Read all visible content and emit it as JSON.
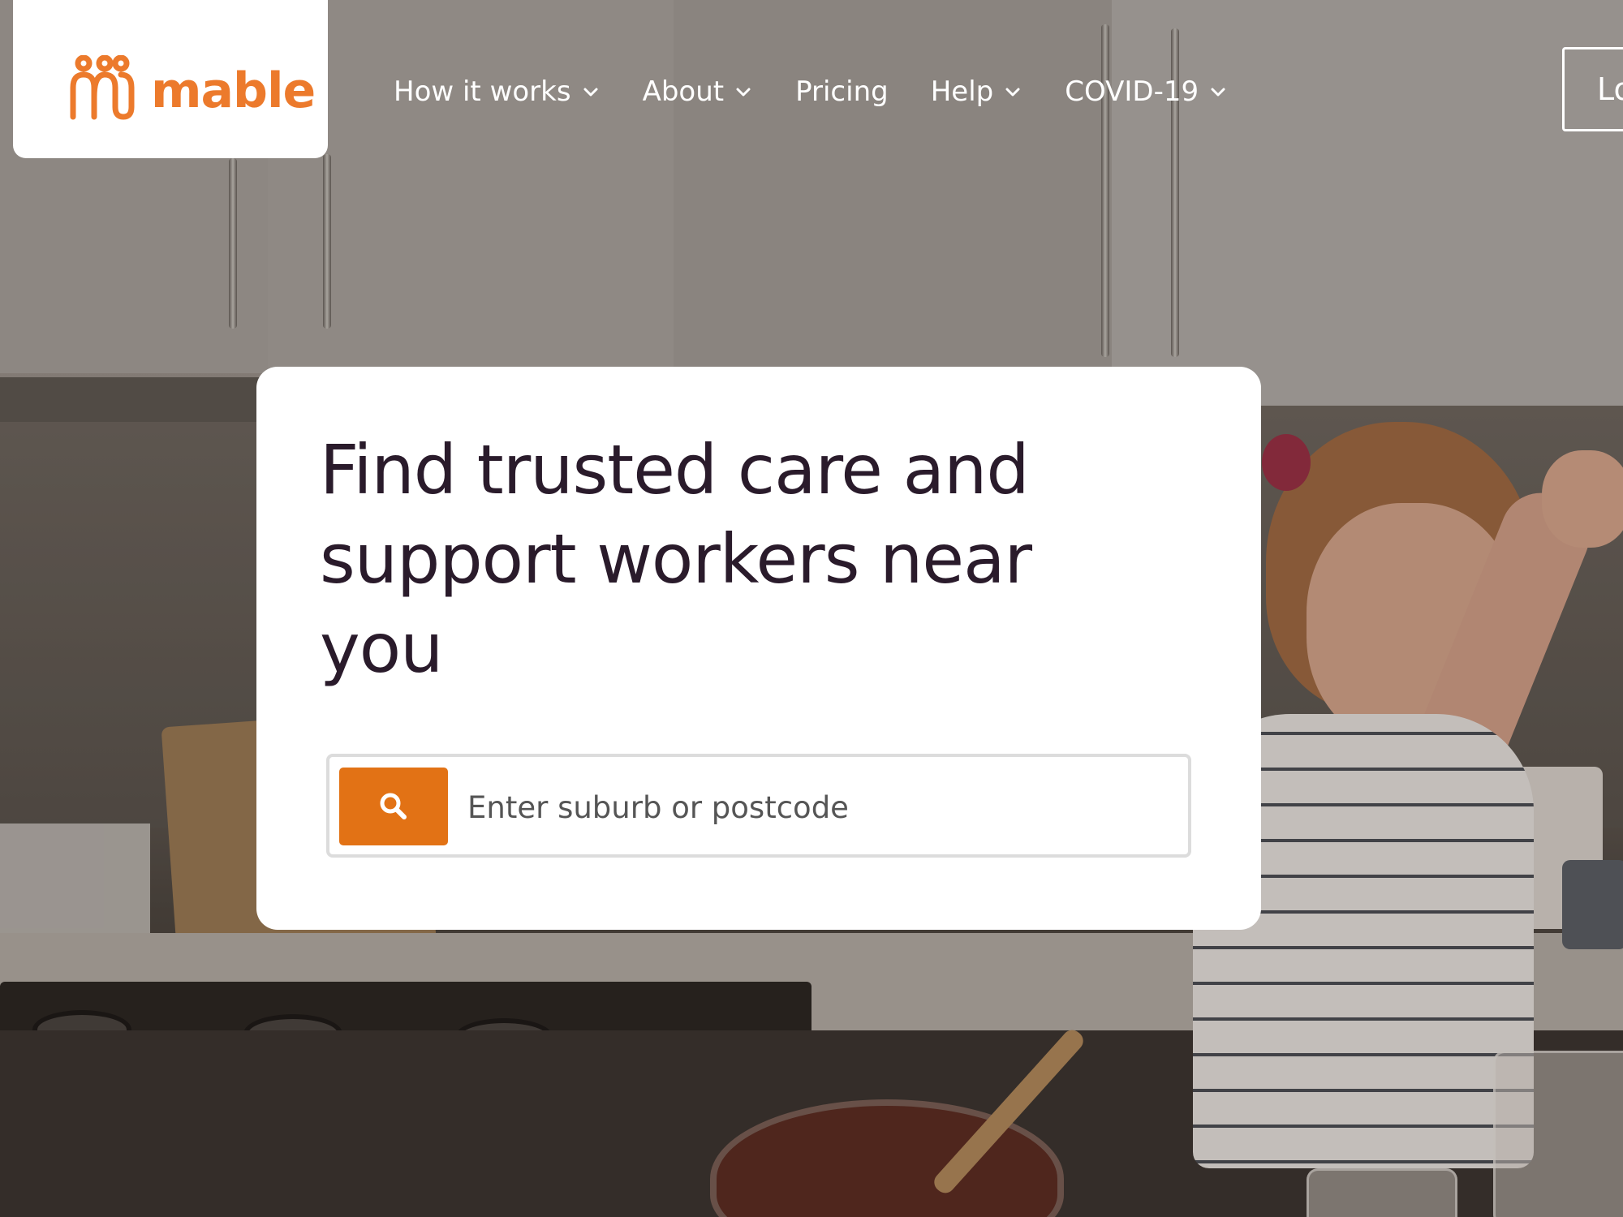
{
  "brand": {
    "name": "mable",
    "color": "#ec7a2c"
  },
  "nav": {
    "items": [
      {
        "label": "How it works",
        "has_dropdown": true
      },
      {
        "label": "About",
        "has_dropdown": true
      },
      {
        "label": "Pricing",
        "has_dropdown": false
      },
      {
        "label": "Help",
        "has_dropdown": true
      },
      {
        "label": "COVID-19",
        "has_dropdown": true
      }
    ],
    "login_label": "Lo"
  },
  "hero": {
    "title": "Find trusted care and support workers near you",
    "search": {
      "placeholder": "Enter suburb or postcode",
      "value": "",
      "button_icon": "search-icon",
      "button_color": "#e27215"
    }
  },
  "icons": {
    "dropdown": "chevron-down-icon",
    "logo": "mable-logo-icon"
  }
}
